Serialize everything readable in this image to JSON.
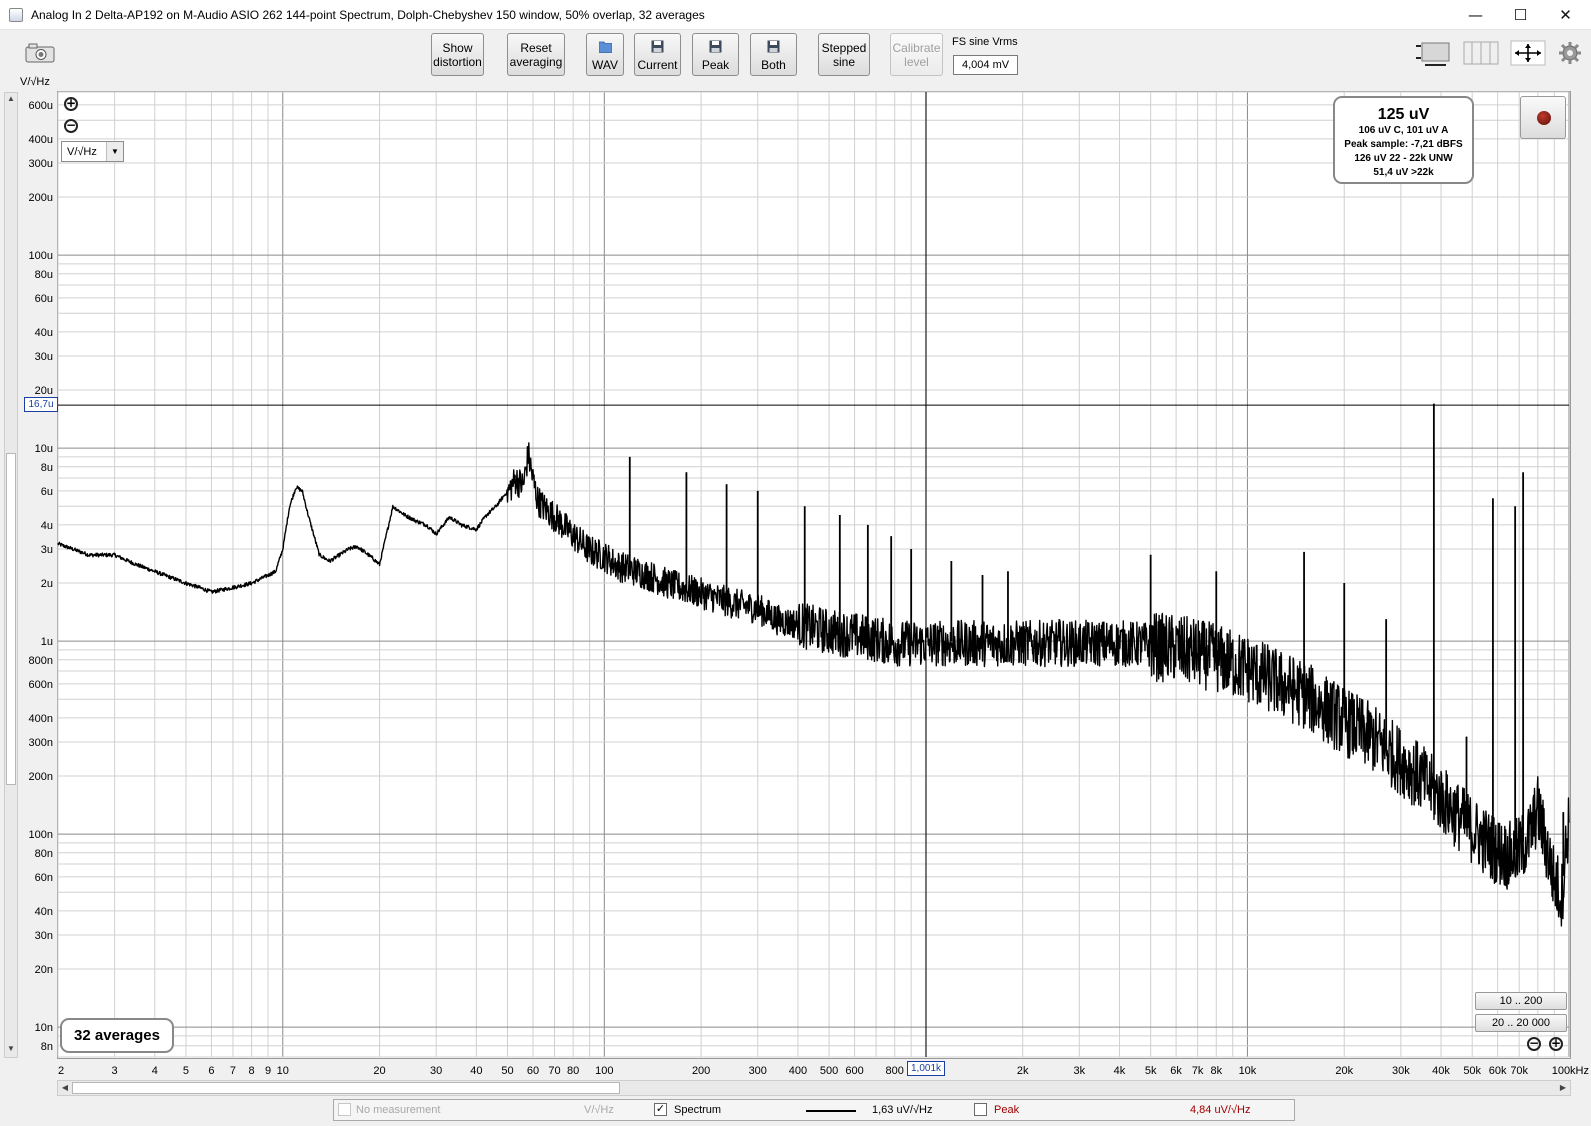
{
  "window": {
    "title": "Analog In 2 Delta-AP192 on M-Audio ASIO 262 144-point Spectrum, Dolph-Chebyshev 150 window, 50% overlap, 32 averages",
    "minimize": "—",
    "maximize": "☐",
    "close": "✕"
  },
  "toolbar": {
    "show_distortion": [
      "Show",
      "distortion"
    ],
    "reset_averaging": [
      "Reset",
      "averaging"
    ],
    "wav": "WAV",
    "current": "Current",
    "peak": "Peak",
    "both": "Both",
    "stepped_sine": [
      "Stepped",
      "sine"
    ],
    "calibrate_level": [
      "Calibrate",
      "level"
    ],
    "fs_label": "FS sine Vrms",
    "fs_value": "4,004 mV",
    "unit_label": "V/√Hz"
  },
  "plot": {
    "unit_select": "V/√Hz",
    "cursor_y": "16,7u",
    "cursor_x": "1,001k",
    "averages_label": "32 averages",
    "range_buttons": [
      "10 .. 200",
      "20 .. 20 000"
    ]
  },
  "readout": {
    "main": "125 uV",
    "lines": [
      "106 uV C, 101 uV A",
      "Peak sample: -7,21 dBFS",
      "126 uV 22 - 22k UNW",
      "51,4 uV >22k"
    ]
  },
  "legend": {
    "no_measurement": "No measurement",
    "no_measurement_unit": "V/√Hz",
    "spectrum": "Spectrum",
    "spectrum_value": "1,63 uV/√Hz",
    "peak": "Peak",
    "peak_value": "4,84 uV/√Hz",
    "spectrum_checked": "✓"
  },
  "chart_data": {
    "type": "line",
    "xscale": "log",
    "yscale": "log",
    "xlim": [
      2,
      100000
    ],
    "ylim": [
      7e-09,
      0.0007
    ],
    "ylabel": "V/√Hz",
    "x_tick_labels": [
      "2",
      "3",
      "4",
      "5",
      "6",
      "7",
      "8",
      "9",
      "10",
      "20",
      "30",
      "40",
      "50",
      "60",
      "70",
      "80",
      "100",
      "200",
      "300",
      "400",
      "500",
      "600",
      "800",
      "1k",
      "2k",
      "3k",
      "4k",
      "5k",
      "6k",
      "7k",
      "8k",
      "10k",
      "20k",
      "30k",
      "40k",
      "50k",
      "60k",
      "70k",
      "100kHz"
    ],
    "x_tick_values": [
      2,
      3,
      4,
      5,
      6,
      7,
      8,
      9,
      10,
      20,
      30,
      40,
      50,
      60,
      70,
      80,
      100,
      200,
      300,
      400,
      500,
      600,
      800,
      1000,
      2000,
      3000,
      4000,
      5000,
      6000,
      7000,
      8000,
      10000,
      20000,
      30000,
      40000,
      50000,
      60000,
      70000,
      100000
    ],
    "y_tick_labels": [
      "600u",
      "400u",
      "300u",
      "200u",
      "100u",
      "80u",
      "60u",
      "40u",
      "30u",
      "20u",
      "10u",
      "8u",
      "6u",
      "4u",
      "3u",
      "2u",
      "1u",
      "800n",
      "600n",
      "400n",
      "300n",
      "200n",
      "100n",
      "80n",
      "60n",
      "40n",
      "30n",
      "20n",
      "10n",
      "8n"
    ],
    "y_tick_values": [
      0.0006,
      0.0004,
      0.0003,
      0.0002,
      0.0001,
      8e-05,
      6e-05,
      4e-05,
      3e-05,
      2e-05,
      1e-05,
      8e-06,
      6e-06,
      4e-06,
      3e-06,
      2e-06,
      1e-06,
      8e-07,
      6e-07,
      4e-07,
      3e-07,
      2e-07,
      1e-07,
      8e-08,
      6e-08,
      4e-08,
      3e-08,
      2e-08,
      1e-08,
      8e-09
    ],
    "cursor": {
      "x": 1001,
      "y": 1.67e-05
    },
    "series": [
      {
        "name": "Spectrum",
        "color": "#000000",
        "x": [
          2,
          2.5,
          3,
          3.5,
          4,
          5,
          5.5,
          6,
          7,
          8,
          9,
          9.5,
          10,
          10.5,
          11,
          11.5,
          12,
          13,
          14,
          15,
          16,
          17,
          18,
          19,
          20,
          22,
          24,
          26,
          28,
          30,
          33,
          36,
          40,
          43,
          46,
          50,
          53,
          56,
          58,
          60,
          62,
          65,
          70,
          75,
          80,
          90,
          100,
          110,
          120,
          140,
          160,
          200,
          250,
          300,
          350,
          400,
          500,
          600,
          700,
          800,
          1000,
          1300,
          1600,
          2000,
          3000,
          4000,
          5000,
          6000,
          7000,
          8000,
          10000,
          12000,
          15000,
          20000,
          25000,
          30000,
          35000,
          40000,
          45000,
          50000,
          55000,
          60000,
          65000,
          70000,
          75000,
          80000,
          85000,
          90000,
          95000,
          100000
        ],
        "y": [
          3.2e-06,
          2.8e-06,
          2.8e-06,
          2.5e-06,
          2.3e-06,
          2e-06,
          1.9e-06,
          1.8e-06,
          1.9e-06,
          2e-06,
          2.2e-06,
          2.3e-06,
          3e-06,
          5e-06,
          6.3e-06,
          6e-06,
          4.5e-06,
          2.8e-06,
          2.6e-06,
          2.8e-06,
          3e-06,
          3.1e-06,
          2.9e-06,
          2.7e-06,
          2.5e-06,
          5e-06,
          4.5e-06,
          4.2e-06,
          4e-06,
          3.6e-06,
          4.4e-06,
          4e-06,
          3.8e-06,
          4.5e-06,
          5e-06,
          6e-06,
          7e-06,
          6.5e-06,
          9.5e-06,
          7e-06,
          5.5e-06,
          5e-06,
          4.5e-06,
          4e-06,
          3.6e-06,
          3e-06,
          2.8e-06,
          2.5e-06,
          2.4e-06,
          2.2e-06,
          2e-06,
          1.8e-06,
          1.6e-06,
          1.5e-06,
          1.3e-06,
          1.25e-06,
          1.15e-06,
          1.1e-06,
          1.05e-06,
          1e-06,
          1e-06,
          1e-06,
          1e-06,
          1e-06,
          1e-06,
          1e-06,
          9.8e-07,
          9.5e-07,
          9e-07,
          8.5e-07,
          7.5e-07,
          6.5e-07,
          5.5e-07,
          4e-07,
          3.2e-07,
          2.5e-07,
          2e-07,
          1.6e-07,
          1.3e-07,
          1.1e-07,
          9.5e-08,
          8.5e-08,
          8e-08,
          8.5e-08,
          1e-07,
          1.4e-07,
          9e-08,
          6e-08,
          5e-08,
          1.3e-07
        ]
      }
    ],
    "spikes": [
      {
        "x": 120,
        "y": 9e-06
      },
      {
        "x": 180,
        "y": 7.5e-06
      },
      {
        "x": 240,
        "y": 6.5e-06
      },
      {
        "x": 300,
        "y": 6e-06
      },
      {
        "x": 420,
        "y": 5e-06
      },
      {
        "x": 540,
        "y": 4.5e-06
      },
      {
        "x": 660,
        "y": 4e-06
      },
      {
        "x": 780,
        "y": 3.5e-06
      },
      {
        "x": 900,
        "y": 3e-06
      },
      {
        "x": 1200,
        "y": 2.6e-06
      },
      {
        "x": 1500,
        "y": 2.2e-06
      },
      {
        "x": 1800,
        "y": 2.3e-06
      },
      {
        "x": 2600,
        "y": 1.3e-06
      },
      {
        "x": 5000,
        "y": 2.8e-06
      },
      {
        "x": 8000,
        "y": 2.3e-06
      },
      {
        "x": 15000,
        "y": 2.9e-06
      },
      {
        "x": 20000,
        "y": 2e-06
      },
      {
        "x": 27000,
        "y": 1.3e-06
      },
      {
        "x": 38000,
        "y": 1.7e-05
      },
      {
        "x": 48000,
        "y": 3.2e-07
      },
      {
        "x": 58000,
        "y": 5.5e-06
      },
      {
        "x": 68000,
        "y": 5e-06
      },
      {
        "x": 72000,
        "y": 7.5e-06
      },
      {
        "x": 96000,
        "y": 1.3e-07
      }
    ]
  }
}
